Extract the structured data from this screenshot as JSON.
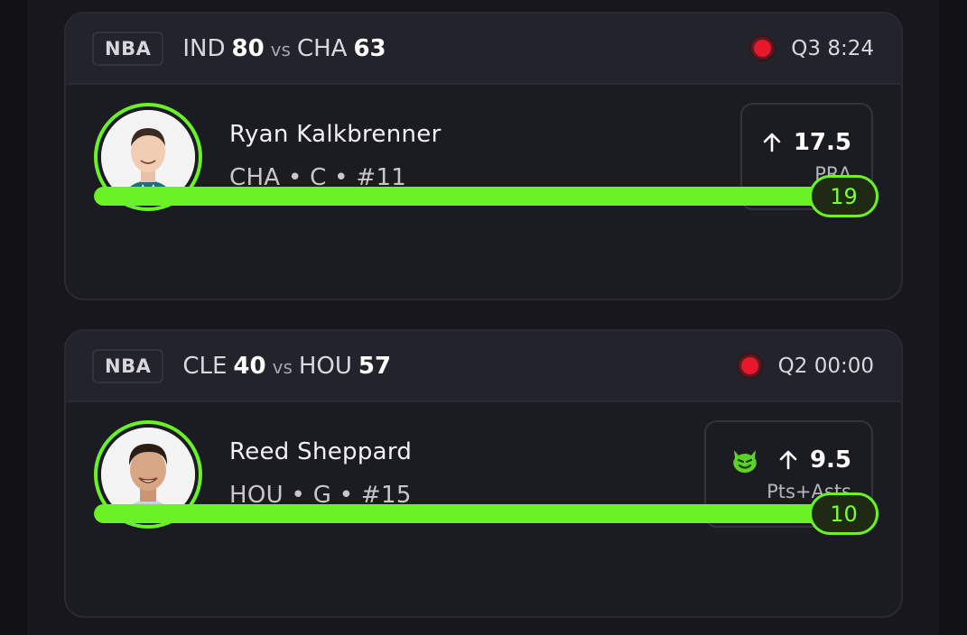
{
  "cards": [
    {
      "league": "NBA",
      "away_team": "IND",
      "away_score": "80",
      "vs": "vs",
      "home_team": "CHA",
      "home_score": "63",
      "game_clock": "Q3 8:24",
      "player": {
        "name": "Ryan Kalkbrenner",
        "meta": "CHA • C • #11"
      },
      "pick": {
        "direction": "up",
        "line": "17.5",
        "stat": "PRA",
        "demon": false
      },
      "current_value": "19",
      "progress_pct": 100,
      "accent": "#6bf227"
    },
    {
      "league": "NBA",
      "away_team": "CLE",
      "away_score": "40",
      "vs": "vs",
      "home_team": "HOU",
      "home_score": "57",
      "game_clock": "Q2 00:00",
      "player": {
        "name": "Reed Sheppard",
        "meta": "HOU • G • #15"
      },
      "pick": {
        "direction": "up",
        "line": "9.5",
        "stat": "Pts+Asts",
        "demon": true
      },
      "current_value": "10",
      "progress_pct": 100,
      "accent": "#6bf227"
    }
  ]
}
